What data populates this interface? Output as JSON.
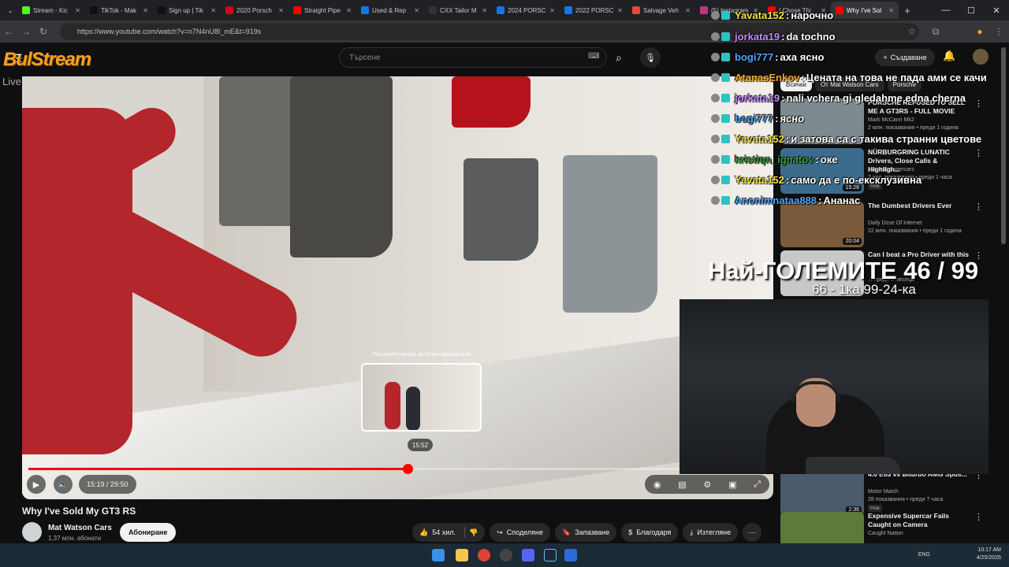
{
  "browser": {
    "tabs": [
      {
        "label": "Stream - Kic",
        "color": "#53fc18"
      },
      {
        "label": "TikTok - Mak",
        "color": "#111111"
      },
      {
        "label": "Sign up | Tik",
        "color": "#111111"
      },
      {
        "label": "2020 Porsch",
        "color": "#d5001c"
      },
      {
        "label": "Straight Pipe",
        "color": "#ff0000"
      },
      {
        "label": "Used & Rep",
        "color": "#1a73e8"
      },
      {
        "label": "CXX Tailor M",
        "color": "#333333"
      },
      {
        "label": "2024 PORSC",
        "color": "#1a73e8"
      },
      {
        "label": "2022 PORSC",
        "color": "#1a73e8"
      },
      {
        "label": "Salvage Veh",
        "color": "#e8453c"
      },
      {
        "label": "(5) Instagram",
        "color": "#c13584"
      },
      {
        "label": "I Chose Thi",
        "color": "#ff0000"
      },
      {
        "label": "Why I've Sol",
        "color": "#ff0000",
        "active": true
      }
    ],
    "url": "https://www.youtube.com/watch?v=n7N4nU8I_mE&t=919s"
  },
  "youtube": {
    "search_placeholder": "Търсене",
    "create_label": "Създаване",
    "overlay_logo": "BulStream",
    "overlay_logo_sub": "Live Broadcasting Services",
    "video": {
      "title": "Why I've Sold My GT3 RS",
      "current_time": "15:19 / 29:50",
      "progress": 0.513,
      "preview_time": "15:52",
      "preview_hint": "Плъзнете нагоре за точно превъртане"
    },
    "channel": {
      "name": "Mat Watson Cars",
      "subs": "1,37 млн. абонати",
      "subscribe_label": "Абониране"
    },
    "actions": {
      "likes": "54 хил.",
      "share": "Споделяне",
      "save": "Запазване",
      "thanks": "Благодаря",
      "download": "Изтегляне"
    },
    "chips": [
      "Всички",
      "От Mat Watson Cars",
      "Porsche"
    ],
    "recommendations": [
      {
        "title": "PORSCHE REFUSED TO SELL ME A GT3RS - FULL MOVIE",
        "channel": "Mark McCann Mk2",
        "meta": "2 млн. показвания • преди 1 година",
        "duration": "",
        "badge": ""
      },
      {
        "title": "NÜRBURGRING LUNATIC Drivers, Close Calls & Highligh...",
        "channel": "statesidesupercars",
        "meta": "2 хил. показвания • преди 1 часа",
        "duration": "15:28",
        "badge": "Нов"
      },
      {
        "title": "The Dumbest Drivers Ever",
        "channel": "Daily Dose Of Internet",
        "meta": "22 млн. показвания • преди 1 година",
        "duration": "20:04",
        "badge": ""
      },
      {
        "title": "Can I beat a Pro Driver with this",
        "channel": "",
        "meta": "... преди 8 месеца",
        "duration": "",
        "badge": ""
      },
      {
        "title": "4.0 E63 vs Biturbo AMG Spds...",
        "channel": "Motor Match",
        "meta": "28 показвания • преди 7 часа",
        "duration": "2:36",
        "badge": "Нов"
      },
      {
        "title": "Expensive Supercar Fails Caught on Camera",
        "channel": "Caught Nation",
        "meta": "",
        "duration": "",
        "badge": ""
      }
    ]
  },
  "stream_overlay": {
    "chat": [
      {
        "user": "Yavata152",
        "text": "нарочно",
        "color": "#f5e04a"
      },
      {
        "user": "jorkata19",
        "text": "da tochno",
        "color": "#c48bff"
      },
      {
        "user": "bogi777",
        "text": "аха ясно",
        "color": "#4da6ff"
      },
      {
        "user": "AtanasEnkov",
        "text": "Цената на това не пада ами се качи",
        "color": "#f5a623"
      },
      {
        "user": "jorkata19",
        "text": "nali vchera gi gledahme edna cherna",
        "color": "#c48bff"
      },
      {
        "user": "bogi777",
        "text": "ясно",
        "color": "#4da6ff"
      },
      {
        "user": "Yavata152",
        "text": "и затова са с такива странни цветове",
        "color": "#f5e04a"
      },
      {
        "user": "kristiqn_ignatov",
        "text": "оке",
        "color": "#3a9a3a"
      },
      {
        "user": "Yavata152",
        "text": "само да е по-ексклузивна",
        "color": "#f5e04a"
      },
      {
        "user": "Anonimnataa888",
        "text": "Ананас",
        "color": "#4da6ff"
      }
    ],
    "goal_title": "Най-ГОЛЕМИТЕ 46 / 99",
    "goal_sub": "66 - 1ка 99-24-ка"
  },
  "taskbar": {
    "time": "10:17 AM",
    "date": "4/25/2026",
    "lang": "ENG"
  }
}
